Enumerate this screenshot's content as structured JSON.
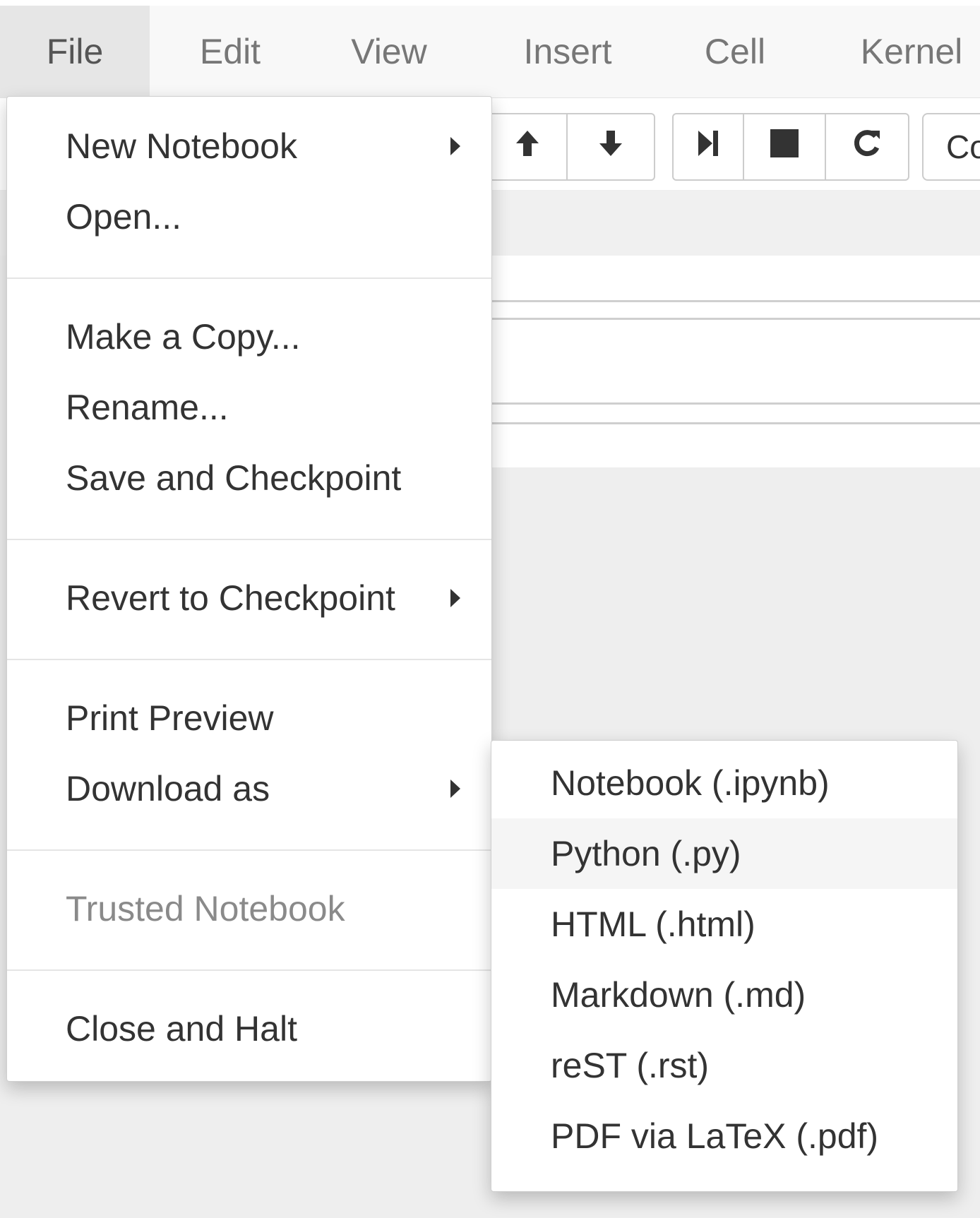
{
  "menubar": {
    "items": [
      {
        "label": "File",
        "active": true
      },
      {
        "label": "Edit"
      },
      {
        "label": "View"
      },
      {
        "label": "Insert"
      },
      {
        "label": "Cell"
      },
      {
        "label": "Kernel"
      }
    ]
  },
  "toolbar": {
    "move_up_icon": "arrow-up-icon",
    "move_down_icon": "arrow-down-icon",
    "run_icon": "step-forward-icon",
    "interrupt_icon": "stop-icon",
    "restart_icon": "restart-icon",
    "cell_type_value": "Co"
  },
  "file_menu": {
    "new_notebook": "New Notebook",
    "open": "Open...",
    "make_copy": "Make a Copy...",
    "rename": "Rename...",
    "save_checkpoint": "Save and Checkpoint",
    "revert_checkpoint": "Revert to Checkpoint",
    "print_preview": "Print Preview",
    "download_as": "Download as",
    "trusted_notebook": "Trusted Notebook",
    "close_halt": "Close and Halt"
  },
  "download_submenu": {
    "items": [
      {
        "label": "Notebook (.ipynb)"
      },
      {
        "label": "Python (.py)",
        "highlighted": true
      },
      {
        "label": "HTML (.html)"
      },
      {
        "label": "Markdown (.md)"
      },
      {
        "label": "reST (.rst)"
      },
      {
        "label": "PDF via LaTeX (.pdf)"
      }
    ]
  }
}
